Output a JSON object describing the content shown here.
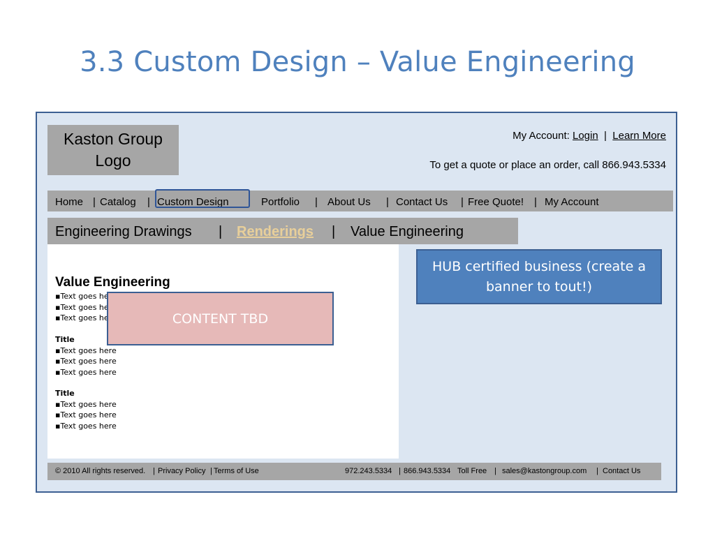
{
  "slide": {
    "title": "3.3 Custom Design – Value Engineering"
  },
  "header": {
    "logo_text_line1": "Kaston Group",
    "logo_text_line2": "Logo",
    "account_prefix": "My Account:",
    "login_label": "Login",
    "account_sep": "|",
    "learn_more_label": "Learn More",
    "quote_text": "To get a quote or place an order, call 866.943.5334"
  },
  "nav": {
    "items": [
      {
        "label": "Home"
      },
      {
        "label": "Catalog"
      },
      {
        "label": "Custom Design"
      },
      {
        "label": "Portfolio"
      },
      {
        "label": "About Us"
      },
      {
        "label": "Contact Us"
      },
      {
        "label": "Free Quote!"
      },
      {
        "label": "My Account"
      }
    ],
    "separator": "|"
  },
  "subnav": {
    "items": [
      {
        "label": "Engineering Drawings"
      },
      {
        "label": "Renderings"
      },
      {
        "label": "Value Engineering"
      }
    ],
    "separator": "|"
  },
  "content": {
    "heading": "Value Engineering",
    "bullet": "▪",
    "group1": [
      "Text goes here",
      "Text goes here",
      "Text goes here"
    ],
    "title2": "Title",
    "group2": [
      "Text goes here",
      "Text goes here",
      "Text goes here"
    ],
    "title3": "Title",
    "group3": [
      "Text goes here",
      "Text goes here",
      "Text goes here"
    ],
    "tbd_label": "CONTENT TBD"
  },
  "banner": {
    "text": "HUB certified business (create a banner to tout!)"
  },
  "footer": {
    "copyright": "© 2010 All rights reserved.",
    "privacy": "Privacy Policy",
    "terms": "Terms of Use",
    "phone1": "972.243.5334",
    "phone2": "866.943.5334",
    "tollfree": "Toll Free",
    "email": "sales@kastongroup.com",
    "contact": "Contact Us",
    "sep": "|"
  },
  "colors": {
    "title_blue": "#4f81bd",
    "frame_bg": "#dce6f2",
    "bar_gray": "#a6a6a6",
    "tbd_pink": "#e6b9b8",
    "banner_blue": "#4f81bd",
    "active_tab": "#e8cf9a"
  }
}
